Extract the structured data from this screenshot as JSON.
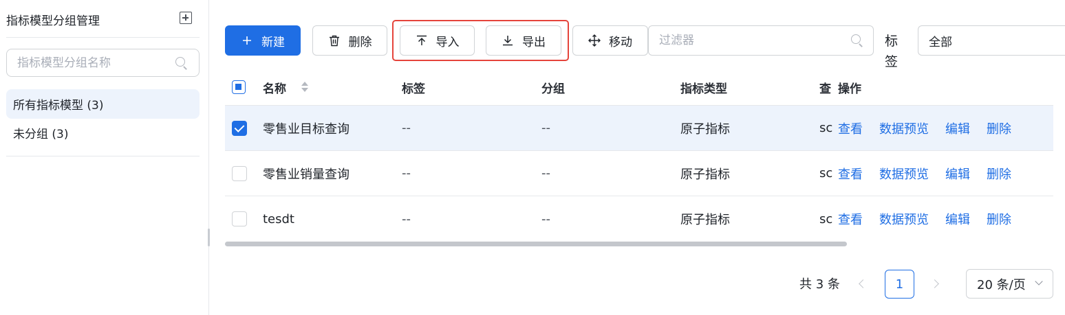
{
  "sidebar": {
    "title": "指标模型分组管理",
    "search_placeholder": "指标模型分组名称",
    "items": [
      {
        "label": "所有指标模型 (3)",
        "active": true
      },
      {
        "label": "未分组 (3)",
        "active": false
      }
    ]
  },
  "toolbar": {
    "new_label": "新建",
    "delete_label": "删除",
    "import_label": "导入",
    "export_label": "导出",
    "move_label": "移动",
    "filter_placeholder": "过滤器",
    "tag_label": "标签",
    "tag_value": "全部"
  },
  "table": {
    "columns": {
      "name": "名称",
      "tag": "标签",
      "group": "分组",
      "type": "指标类型",
      "query": "查",
      "ops": "操作"
    },
    "rows": [
      {
        "name": "零售业目标查询",
        "tag": "--",
        "group": "--",
        "type": "原子指标",
        "query": "sc",
        "checked": true
      },
      {
        "name": "零售业销量查询",
        "tag": "--",
        "group": "--",
        "type": "原子指标",
        "query": "sc",
        "checked": false
      },
      {
        "name": "tesdt",
        "tag": "--",
        "group": "--",
        "type": "原子指标",
        "query": "sc",
        "checked": false
      }
    ],
    "ops": {
      "view": "查看",
      "preview": "数据预览",
      "edit": "编辑",
      "delete": "删除"
    }
  },
  "pagination": {
    "total": "共 3 条",
    "current_page": "1",
    "page_size": "20 条/页"
  },
  "colors": {
    "primary": "#1f6ee4",
    "highlight_border": "#e5443b",
    "selected_row_bg": "#edf3fc"
  }
}
